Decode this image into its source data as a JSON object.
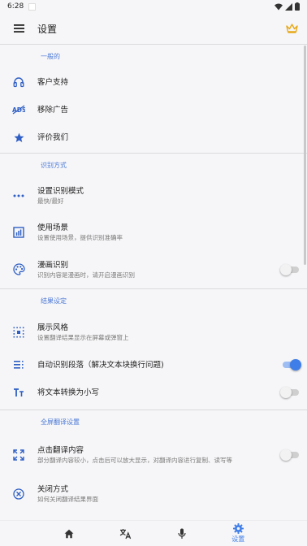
{
  "status_bar": {
    "time": "6:28"
  },
  "app_bar": {
    "title": "设置"
  },
  "sections": [
    {
      "header": "一般的",
      "items": [
        {
          "title": "客户支持",
          "icon": "headset-icon"
        },
        {
          "title": "移除广告",
          "icon": "no-ads-icon"
        },
        {
          "title": "评价我们",
          "icon": "star-icon"
        }
      ]
    },
    {
      "header": "识别方式",
      "items": [
        {
          "title": "设置识别模式",
          "subtitle": "最快/最好",
          "icon": "more-dots-icon"
        },
        {
          "title": "使用场景",
          "subtitle": "设置使用场景，提供识别准确率",
          "icon": "chart-icon"
        },
        {
          "title": "漫画识别",
          "subtitle": "识别内容是漫画时，请开启漫画识别",
          "icon": "palette-icon",
          "toggle": false
        }
      ]
    },
    {
      "header": "结果设定",
      "items": [
        {
          "title": "展示风格",
          "subtitle": "设置翻译结果显示在屏幕或弹窗上",
          "icon": "dotted-square-icon"
        },
        {
          "title": "自动识别段落（解决文本块换行问题)",
          "icon": "paragraph-icon",
          "toggle": true
        },
        {
          "title": "将文本转换为小写",
          "icon": "text-case-icon",
          "toggle": false
        }
      ]
    },
    {
      "header": "全屏翻译设置",
      "items": [
        {
          "title": "点击翻译内容",
          "subtitle": "部分翻译内容较小，点击后可以放大显示，对翻译内容进行复制、读写等",
          "icon": "expand-icon",
          "toggle": false
        },
        {
          "title": "关闭方式",
          "subtitle": "如何关闭翻译结果界面",
          "icon": "close-circle-icon"
        }
      ]
    }
  ],
  "bottom_nav": [
    {
      "icon": "home-icon",
      "label": ""
    },
    {
      "icon": "translate-icon",
      "label": ""
    },
    {
      "icon": "microphone-icon",
      "label": ""
    },
    {
      "icon": "gear-icon",
      "label": "设置",
      "active": true
    }
  ],
  "colors": {
    "accent": "#3f7ee8",
    "section_header": "#4a78d6",
    "icon": "#2f5fc4",
    "crown": "#e6a817",
    "background": "#f6f6f8"
  }
}
